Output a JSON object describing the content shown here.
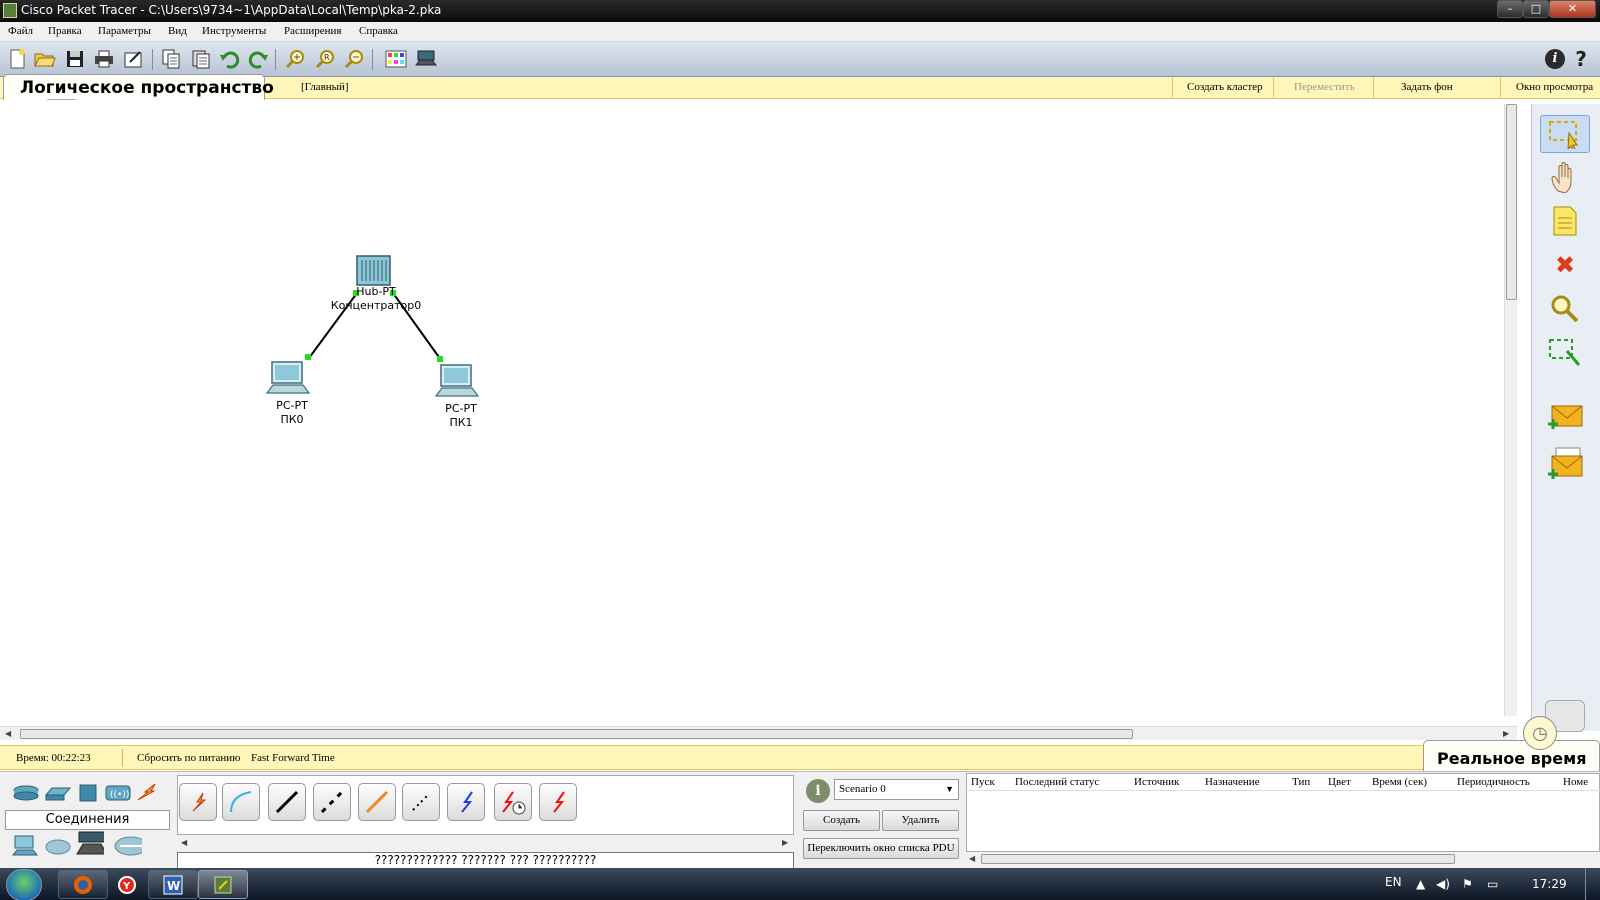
{
  "window": {
    "title": "Cisco Packet Tracer - C:\\Users\\9734~1\\AppData\\Local\\Temp\\pka-2.pka",
    "controls": [
      "–",
      "□",
      "✕"
    ]
  },
  "menu": [
    "Файл",
    "Правка",
    "Параметры",
    "Вид",
    "Инструменты",
    "Расширения",
    "Справка"
  ],
  "toolbar": {
    "icons": [
      "new-file",
      "open-folder",
      "save",
      "print",
      "activity-wizard",
      "copy",
      "paste",
      "undo",
      "redo",
      "zoom-in",
      "zoom-reset",
      "zoom-out",
      "palette",
      "custom-device"
    ]
  },
  "workspace": {
    "title": "Логическое пространство",
    "main_label": "[Главный]",
    "actions": [
      {
        "label": "Создать кластер",
        "enabled": true
      },
      {
        "label": "Переместить",
        "enabled": false
      },
      {
        "label": "Задать фон",
        "enabled": true
      },
      {
        "label": "Окно просмотра",
        "enabled": true
      }
    ]
  },
  "topology": {
    "nodes": [
      {
        "id": "hub",
        "type": "Hub-PT",
        "name": "Концентратор0"
      },
      {
        "id": "pc0",
        "type": "PC-PT",
        "name": "ПК0"
      },
      {
        "id": "pc1",
        "type": "PC-PT",
        "name": "ПК1"
      }
    ],
    "links": [
      {
        "from": "hub",
        "to": "pc0",
        "status": "up",
        "link_color": "#000000",
        "port_color": "#22dd22"
      },
      {
        "from": "hub",
        "to": "pc1",
        "status": "up",
        "link_color": "#000000",
        "port_color": "#22dd22"
      }
    ]
  },
  "palette": {
    "tools": [
      "select-tool",
      "move-hand-tool",
      "note-tool",
      "delete-tool",
      "inspect-tool",
      "resize-tool",
      "simple-pdu-tool",
      "complex-pdu-tool"
    ],
    "active": "select-tool"
  },
  "timebar": {
    "time_label": "Время: 00:22:23",
    "power_cycle": "Сбросить по питанию",
    "fast_forward": "Fast Forward Time",
    "mode_title": "Реальное время"
  },
  "devices": {
    "category_label": "Соединения",
    "status_text": "????????????? ??????? ??? ??????????",
    "connection_types": [
      "auto-connection",
      "console",
      "copper-straight",
      "copper-cross",
      "fiber",
      "phone",
      "coaxial",
      "serial-dce",
      "serial-dte"
    ]
  },
  "scenario": {
    "selected": "Scenario 0",
    "create_label": "Создать",
    "delete_label": "Удалить",
    "toggle_label": "Переключить окно списка PDU"
  },
  "pdu_table": {
    "columns": [
      "Пуск",
      "Последний статус",
      "Источник",
      "Назначение",
      "Тип",
      "Цвет",
      "Время (сек)",
      "Периодичность",
      "Номе"
    ]
  },
  "taskbar": {
    "language": "EN",
    "clock": "17:29",
    "apps": [
      "firefox",
      "yandex-browser",
      "word",
      "packet-tracer"
    ]
  }
}
